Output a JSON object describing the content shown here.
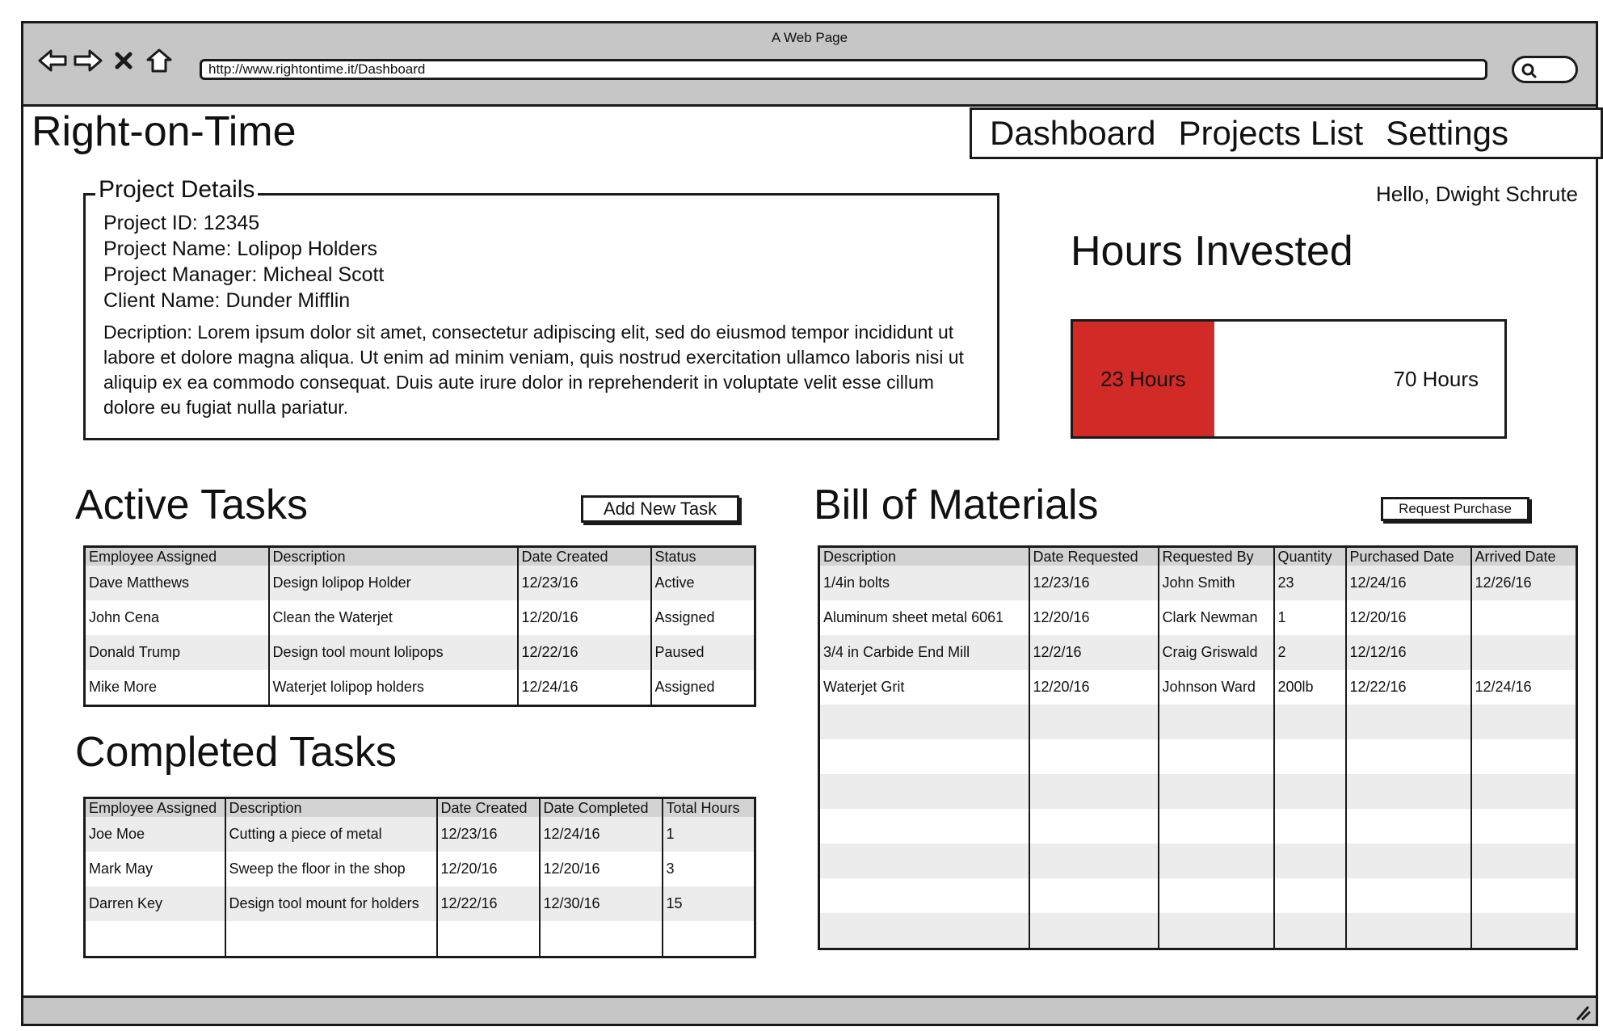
{
  "window": {
    "title": "A Web Page",
    "url": "http://www.rightontime.it/Dashboard"
  },
  "app": {
    "title": "Right-on-Time"
  },
  "nav": {
    "items": [
      "Dashboard",
      "Projects List",
      "Settings"
    ]
  },
  "user": {
    "greeting": "Hello, Dwight Schrute"
  },
  "project": {
    "legend": "Project Details",
    "id_line": "Project ID: 12345",
    "name_line": "Project Name: Lolipop Holders",
    "manager_line": "Project Manager: Micheal Scott",
    "client_line": "Client Name: Dunder Mifflin",
    "description": "Decription: Lorem ipsum dolor sit amet, consectetur adipiscing elit, sed do eiusmod tempor incididunt ut labore et dolore magna aliqua. Ut enim ad minim veniam, quis nostrud exercitation ullamco laboris nisi ut aliquip ex ea commodo consequat. Duis aute irure dolor in reprehenderit in voluptate velit esse cillum dolore eu fugiat nulla pariatur."
  },
  "hours": {
    "title": "Hours Invested",
    "used_label": "23 Hours",
    "total_label": "70 Hours",
    "used": 23,
    "total": 70,
    "fill_color": "#d22b27"
  },
  "active_tasks": {
    "title": "Active Tasks",
    "add_button": "Add New Task",
    "columns": [
      "Employee Assigned",
      "Description",
      "Date Created",
      "Status"
    ],
    "rows": [
      [
        "Dave Matthews",
        "Design lolipop Holder",
        "12/23/16",
        "Active"
      ],
      [
        "John Cena",
        "Clean the Waterjet",
        "12/20/16",
        "Assigned"
      ],
      [
        "Donald Trump",
        "Design tool mount lolipops",
        "12/22/16",
        "Paused"
      ],
      [
        "Mike More",
        "Waterjet lolipop holders",
        "12/24/16",
        "Assigned"
      ]
    ]
  },
  "completed_tasks": {
    "title": "Completed Tasks",
    "columns": [
      "Employee Assigned",
      "Description",
      "Date Created",
      "Date Completed",
      "Total Hours"
    ],
    "rows": [
      [
        "Joe Moe",
        "Cutting a piece of metal",
        "12/23/16",
        "12/24/16",
        "1"
      ],
      [
        "Mark May",
        "Sweep the floor in the shop",
        "12/20/16",
        "12/20/16",
        "3"
      ],
      [
        "Darren Key",
        "Design tool mount for holders",
        "12/22/16",
        "12/30/16",
        "15"
      ]
    ]
  },
  "bill_of_materials": {
    "title": "Bill of Materials",
    "request_button": "Request Purchase",
    "columns": [
      "Description",
      "Date Requested",
      "Requested By",
      "Quantity",
      "Purchased Date",
      "Arrived Date"
    ],
    "rows": [
      [
        "1/4in bolts",
        "12/23/16",
        "John Smith",
        "23",
        "12/24/16",
        "12/26/16"
      ],
      [
        "Aluminum sheet metal 6061",
        "12/20/16",
        "Clark Newman",
        "1",
        "12/20/16",
        ""
      ],
      [
        "3/4 in Carbide End Mill",
        "12/2/16",
        "Craig Griswald",
        "2",
        "12/12/16",
        ""
      ],
      [
        "Waterjet Grit",
        "12/20/16",
        "Johnson Ward",
        "200lb",
        "12/22/16",
        "12/24/16"
      ]
    ]
  },
  "icons": [
    "back-arrow-icon",
    "forward-arrow-icon",
    "close-icon",
    "home-icon",
    "search-icon",
    "resize-grip-icon"
  ]
}
